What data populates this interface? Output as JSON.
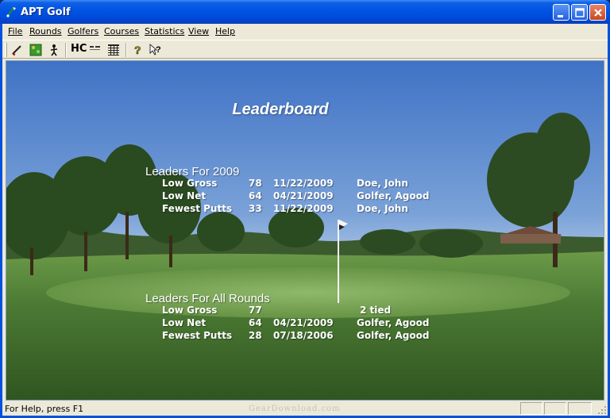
{
  "window": {
    "title": "APT Golf"
  },
  "menu": [
    "File",
    "Rounds",
    "Golfers",
    "Courses",
    "Statistics",
    "View",
    "Help"
  ],
  "toolbar": {
    "buttons": [
      "edit-round-icon",
      "course-map-icon",
      "golfer-icon",
      "handicap",
      "scorecard-icon",
      "stats-grid-icon",
      "help-icon",
      "context-help-icon"
    ],
    "handicap_label": "HC"
  },
  "leaderboard": {
    "title": "Leaderboard",
    "year_section": {
      "title": "Leaders For 2009",
      "rows": [
        {
          "category": "Low Gross",
          "score": "78",
          "date": "11/22/2009",
          "golfer": "Doe, John"
        },
        {
          "category": "Low Net",
          "score": "64",
          "date": "04/21/2009",
          "golfer": "Golfer, Agood"
        },
        {
          "category": "Fewest Putts",
          "score": "33",
          "date": "11/22/2009",
          "golfer": "Doe, John"
        }
      ]
    },
    "all_section": {
      "title": "Leaders For All Rounds",
      "rows": [
        {
          "category": "Low Gross",
          "score": "77",
          "date": "",
          "golfer": "2 tied"
        },
        {
          "category": "Low Net",
          "score": "64",
          "date": "04/21/2009",
          "golfer": "Golfer, Agood"
        },
        {
          "category": "Fewest Putts",
          "score": "28",
          "date": "07/18/2006",
          "golfer": "Golfer, Agood"
        }
      ]
    }
  },
  "status": {
    "text": "For Help, press F1",
    "watermark": "GearDownload.com"
  },
  "colors": {
    "titlebar": "#0054e3",
    "chrome": "#ece9d8",
    "sky": "#6a95d2",
    "grass": "#3f6a2c",
    "text": "#ffffff"
  }
}
